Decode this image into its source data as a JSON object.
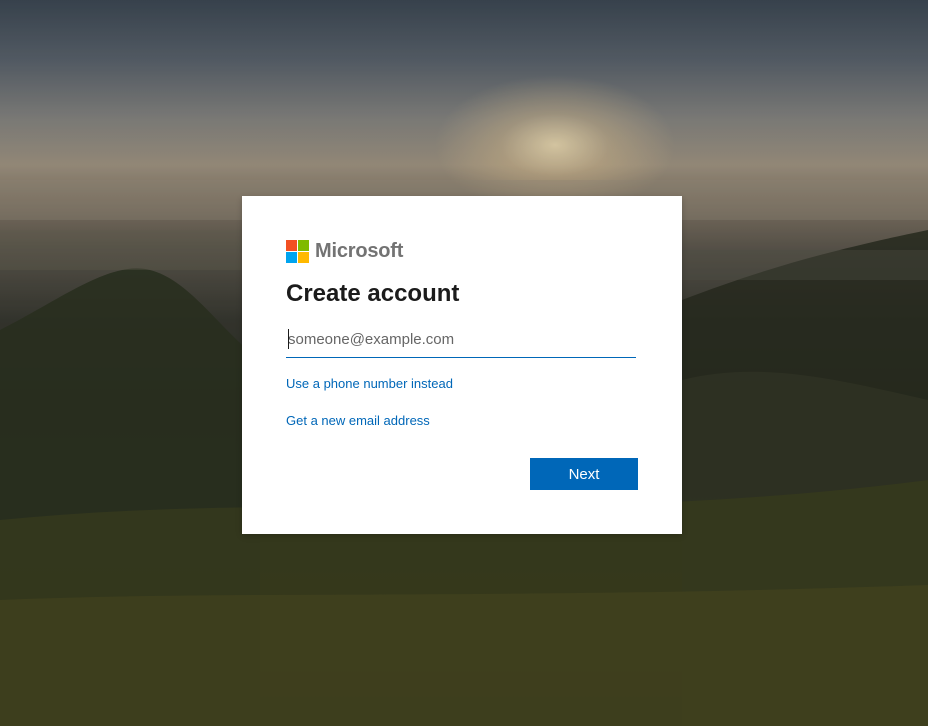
{
  "brand": {
    "name": "Microsoft",
    "logo_colors": [
      "#f25022",
      "#7fba00",
      "#00a4ef",
      "#ffb900"
    ]
  },
  "form": {
    "title": "Create account",
    "email_placeholder": "someone@example.com",
    "email_value": "",
    "phone_link": "Use a phone number instead",
    "new_email_link": "Get a new email address",
    "next_label": "Next"
  },
  "colors": {
    "accent": "#0067b8",
    "title_text": "#1b1b1b",
    "logo_text": "#737373"
  }
}
